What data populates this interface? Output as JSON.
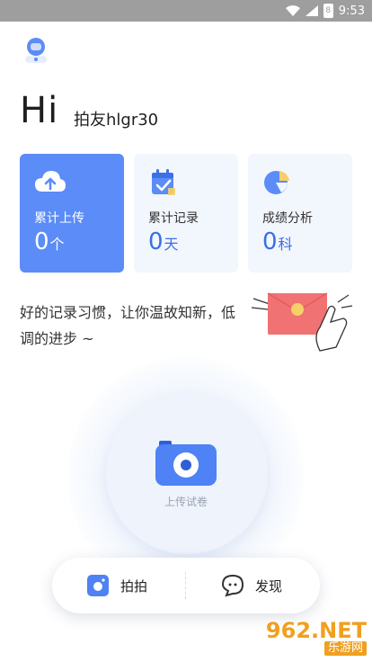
{
  "status_bar": {
    "time": "9:53",
    "battery": "8"
  },
  "header": {
    "greeting": "Hi",
    "username": "拍友hlgr30"
  },
  "cards": [
    {
      "label": "累计上传",
      "value": "0",
      "unit": "个",
      "icon": "cloud-upload-icon",
      "active": true
    },
    {
      "label": "累计记录",
      "value": "0",
      "unit": "天",
      "icon": "calendar-check-icon",
      "active": false
    },
    {
      "label": "成绩分析",
      "value": "0",
      "unit": "科",
      "icon": "pie-chart-icon",
      "active": false
    }
  ],
  "slogan": "好的记录习惯，让你温故知新，低调的进步 ~",
  "upload": {
    "label": "上传试卷",
    "icon": "camera-icon"
  },
  "nav": {
    "left": {
      "label": "拍拍",
      "icon": "camera-small-icon"
    },
    "right": {
      "label": "发现",
      "icon": "chat-bubble-icon"
    }
  },
  "watermark": {
    "brand": "962.NET",
    "sub": "乐游网"
  },
  "colors": {
    "accent": "#5b8cf7",
    "accent_text": "#3a6fe8",
    "card_bg": "#f2f6fd",
    "statusbar": "#9e9e9e"
  }
}
